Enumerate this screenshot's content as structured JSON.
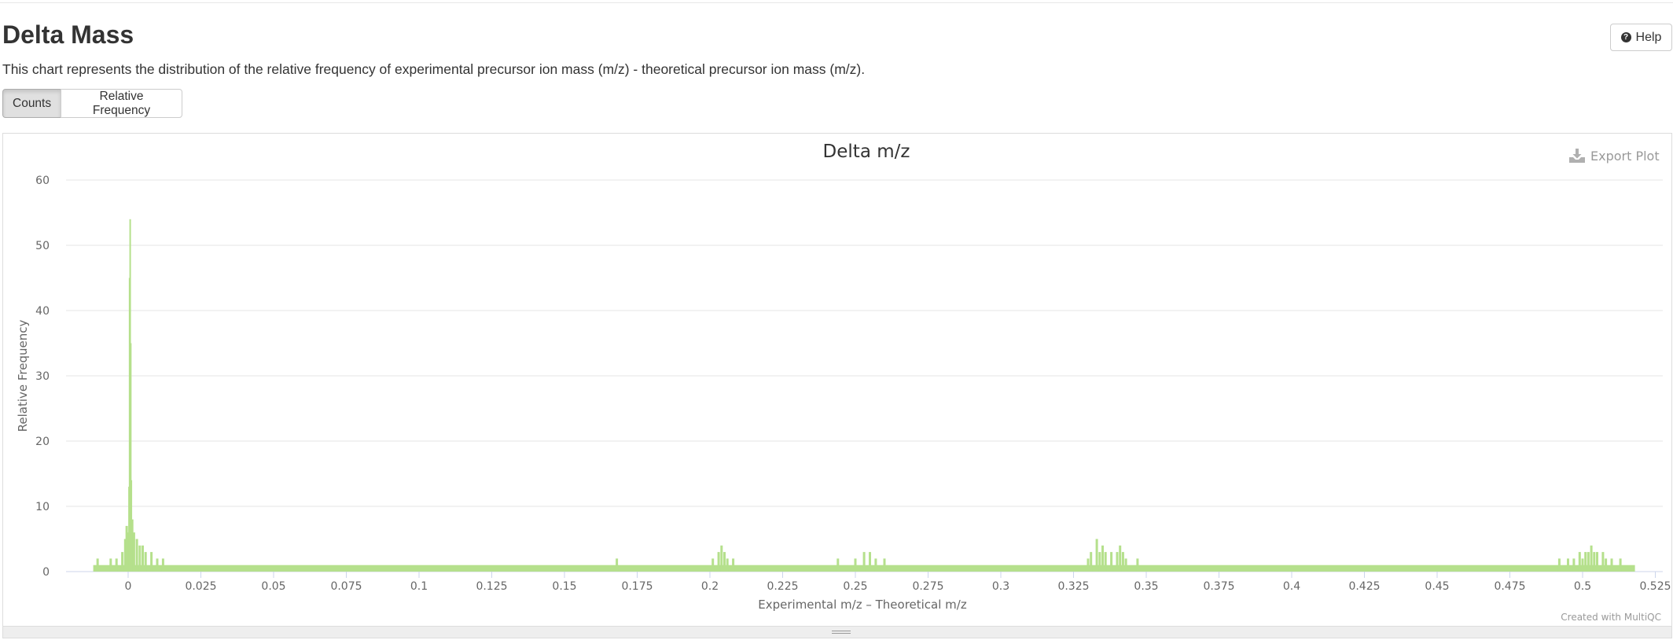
{
  "header": {
    "title": "Delta Mass",
    "description": "This chart represents the distribution of the relative frequency of experimental precursor ion mass (m/z) - theoretical precursor ion mass (m/z).",
    "help_label": "Help",
    "help_icon": "question-circle-icon"
  },
  "toggle": {
    "counts_label": "Counts",
    "relative_label": "Relative Frequency",
    "active": "Counts"
  },
  "plot": {
    "export_label": "Export Plot",
    "export_icon": "download-icon",
    "credit": "Created with MultiQC"
  },
  "chart_data": {
    "type": "area",
    "title": "Delta m/z",
    "xlabel": "Experimental m/z – Theoretical m/z",
    "ylabel": "Relative Frequency",
    "xlim": [
      -0.02,
      0.53
    ],
    "ylim": [
      0,
      60
    ],
    "xticks": [
      "0",
      "0.025",
      "0.05",
      "0.075",
      "0.1",
      "0.125",
      "0.15",
      "0.175",
      "0.2",
      "0.225",
      "0.25",
      "0.275",
      "0.3",
      "0.325",
      "0.35",
      "0.375",
      "0.4",
      "0.425",
      "0.45",
      "0.475",
      "0.5",
      "0.525"
    ],
    "xtick_values": [
      0,
      0.025,
      0.05,
      0.075,
      0.1,
      0.125,
      0.15,
      0.175,
      0.2,
      0.225,
      0.25,
      0.275,
      0.3,
      0.325,
      0.35,
      0.375,
      0.4,
      0.425,
      0.45,
      0.475,
      0.5,
      0.525
    ],
    "yticks": [
      "0",
      "10",
      "20",
      "30",
      "40",
      "50",
      "60"
    ],
    "ytick_values": [
      0,
      10,
      20,
      30,
      40,
      50,
      60
    ],
    "grid": true,
    "baseline": 1,
    "x_range": [
      -0.012,
      0.518
    ],
    "color": "#b5e08c",
    "points": [
      [
        -0.0105,
        2
      ],
      [
        -0.006,
        2
      ],
      [
        -0.004,
        2
      ],
      [
        -0.002,
        3
      ],
      [
        -0.001,
        5
      ],
      [
        -0.0005,
        7
      ],
      [
        0.0,
        6
      ],
      [
        0.0003,
        13
      ],
      [
        0.0005,
        45
      ],
      [
        0.0007,
        54
      ],
      [
        0.0009,
        35
      ],
      [
        0.0011,
        14
      ],
      [
        0.0014,
        8
      ],
      [
        0.002,
        6
      ],
      [
        0.003,
        5
      ],
      [
        0.004,
        4
      ],
      [
        0.005,
        4
      ],
      [
        0.006,
        3
      ],
      [
        0.008,
        3
      ],
      [
        0.01,
        2
      ],
      [
        0.012,
        2
      ],
      [
        0.168,
        2
      ],
      [
        0.201,
        2
      ],
      [
        0.203,
        3
      ],
      [
        0.204,
        4
      ],
      [
        0.205,
        3
      ],
      [
        0.206,
        2
      ],
      [
        0.208,
        2
      ],
      [
        0.244,
        2
      ],
      [
        0.25,
        2
      ],
      [
        0.253,
        3
      ],
      [
        0.255,
        3
      ],
      [
        0.257,
        2
      ],
      [
        0.26,
        2
      ],
      [
        0.33,
        2
      ],
      [
        0.331,
        3
      ],
      [
        0.333,
        5
      ],
      [
        0.334,
        3
      ],
      [
        0.335,
        4
      ],
      [
        0.336,
        3
      ],
      [
        0.338,
        3
      ],
      [
        0.34,
        3
      ],
      [
        0.341,
        4
      ],
      [
        0.342,
        3
      ],
      [
        0.343,
        2
      ],
      [
        0.347,
        2
      ],
      [
        0.492,
        2
      ],
      [
        0.495,
        2
      ],
      [
        0.497,
        2
      ],
      [
        0.499,
        3
      ],
      [
        0.5,
        2
      ],
      [
        0.501,
        3
      ],
      [
        0.502,
        3
      ],
      [
        0.503,
        4
      ],
      [
        0.504,
        3
      ],
      [
        0.505,
        3
      ],
      [
        0.507,
        3
      ],
      [
        0.508,
        2
      ],
      [
        0.51,
        2
      ],
      [
        0.513,
        2
      ]
    ]
  }
}
